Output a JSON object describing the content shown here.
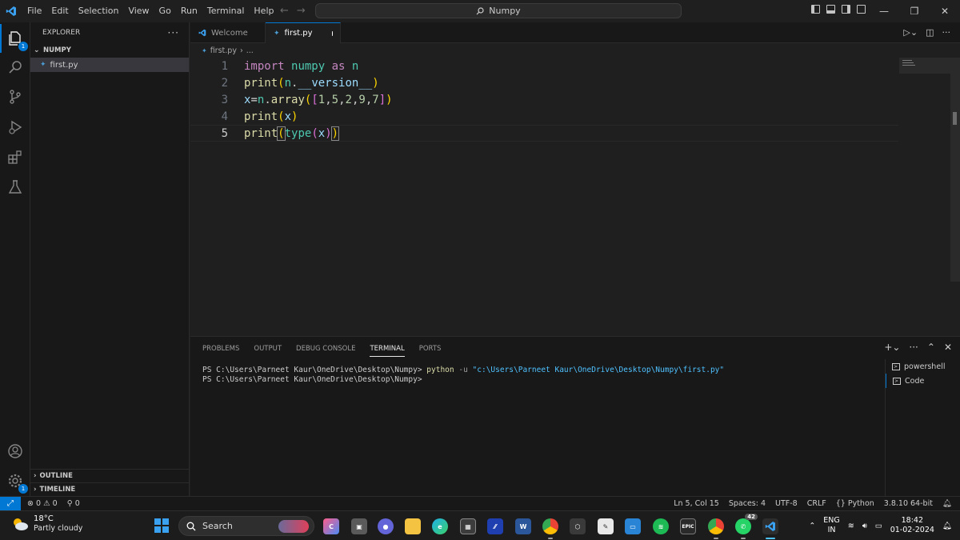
{
  "titlebar": {
    "menu": [
      "File",
      "Edit",
      "Selection",
      "View",
      "Go",
      "Run",
      "Terminal",
      "Help"
    ],
    "search_text": "Numpy"
  },
  "activity": {
    "explorer_badge": "1",
    "manage_badge": "1"
  },
  "sidebar": {
    "title": "EXPLORER",
    "folder": "NUMPY",
    "file": "first.py",
    "outline": "OUTLINE",
    "timeline": "TIMELINE"
  },
  "tabs": [
    {
      "label": "Welcome"
    },
    {
      "label": "first.py"
    }
  ],
  "breadcrumb": {
    "file": "first.py",
    "rest": "..."
  },
  "editor": {
    "line_numbers": [
      "1",
      "2",
      "3",
      "4",
      "5"
    ],
    "lines": [
      "import numpy as n",
      "print(n.__version__)",
      "x=n.array([1,5,2,9,7])",
      "print(x)",
      "print(type(x))"
    ]
  },
  "panel": {
    "tabs": [
      "PROBLEMS",
      "OUTPUT",
      "DEBUG CONSOLE",
      "TERMINAL",
      "PORTS"
    ],
    "prompt": "PS C:\\Users\\Parneet Kaur\\OneDrive\\Desktop\\Numpy>",
    "cmd_python": "python",
    "cmd_flag": "-u",
    "cmd_path": "\"c:\\Users\\Parneet Kaur\\OneDrive\\Desktop\\Numpy\\first.py\"",
    "terminals": [
      "powershell",
      "Code"
    ]
  },
  "status": {
    "errors": "0",
    "warnings": "0",
    "ports": "0",
    "position": "Ln 5, Col 15",
    "spaces": "Spaces: 4",
    "encoding": "UTF-8",
    "eol": "CRLF",
    "language": "Python",
    "interpreter": "3.8.10 64-bit"
  },
  "taskbar": {
    "temperature": "18°C",
    "weather": "Partly cloudy",
    "search": "Search",
    "whatsapp_badge": "42",
    "lang_top": "ENG",
    "lang_bottom": "IN",
    "time": "18:42",
    "date": "01-02-2024"
  },
  "colors": {
    "accent": "#0078d4",
    "bg": "#1f1f1f",
    "panel": "#181818"
  }
}
